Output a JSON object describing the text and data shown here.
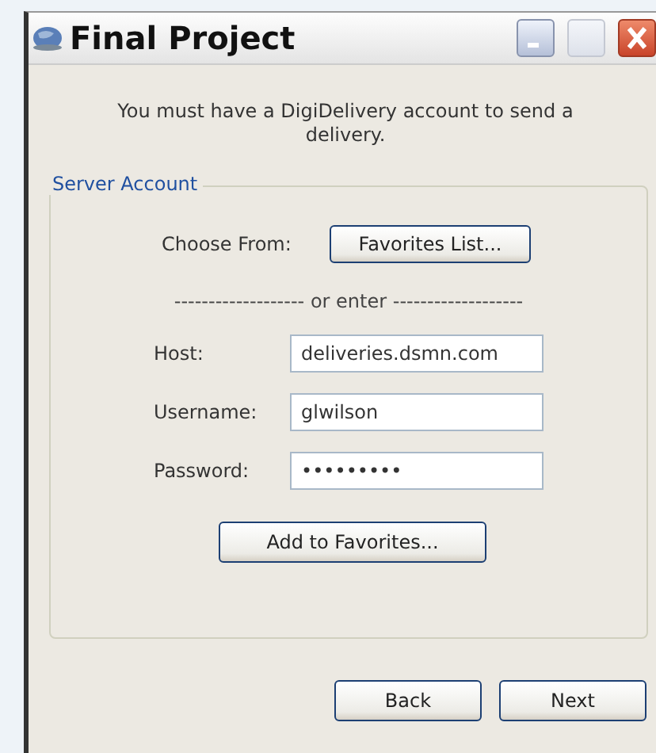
{
  "window": {
    "title": "Final Project"
  },
  "message": "You must have a DigiDelivery account to send a delivery.",
  "group": {
    "title": "Server Account",
    "choose_label": "Choose From:",
    "favorites_button": "Favorites List...",
    "separator": "------------------- or enter -------------------",
    "fields": [
      {
        "label": "Host:",
        "value": "deliveries.dsmn.com"
      },
      {
        "label": "Username:",
        "value": "glwilson"
      },
      {
        "label": "Password:",
        "value": "•••••••••"
      }
    ],
    "add_button": "Add to Favorites..."
  },
  "buttons": [
    "Back",
    "Next"
  ]
}
